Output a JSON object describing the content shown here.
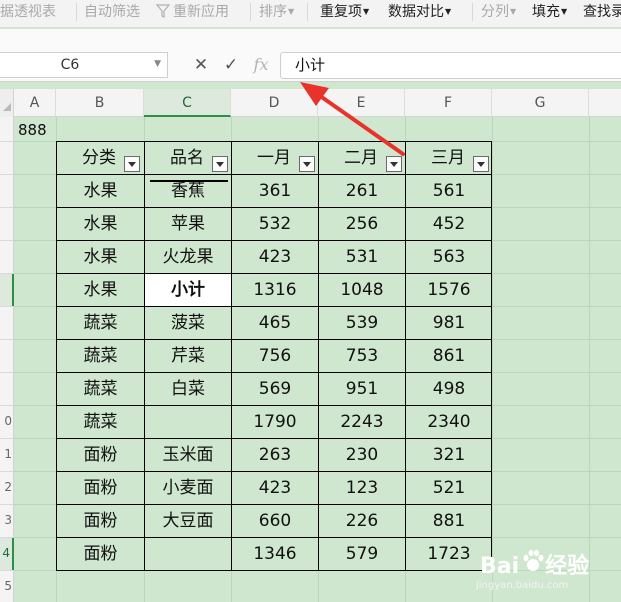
{
  "ribbon": {
    "items": [
      {
        "label": "据透视表",
        "state": "disabled",
        "dropdown": false
      },
      {
        "label": "自动筛选",
        "state": "disabled",
        "dropdown": false
      },
      {
        "label": "重新应用",
        "state": "disabled",
        "dropdown": false,
        "icon": "funnel-icon"
      },
      {
        "label": "排序",
        "state": "disabled",
        "dropdown": true
      },
      {
        "label": "重复项",
        "state": "enabled",
        "dropdown": true
      },
      {
        "label": "数据对比",
        "state": "enabled",
        "dropdown": true
      },
      {
        "label": "分列",
        "state": "disabled",
        "dropdown": true
      },
      {
        "label": "填充",
        "state": "enabled",
        "dropdown": true
      },
      {
        "label": "查找录",
        "state": "enabled",
        "dropdown": false
      }
    ]
  },
  "formula_bar": {
    "name_box": "C6",
    "cancel_icon": "✕",
    "confirm_icon": "✓",
    "fx_label": "fx",
    "value": "小计"
  },
  "grid": {
    "columns": [
      "A",
      "B",
      "C",
      "D",
      "E",
      "F",
      "G"
    ],
    "selected_column": "C",
    "row_labels": [
      "",
      "",
      "",
      "",
      "",
      "",
      "",
      "0",
      "1",
      "2",
      "3",
      "4",
      "5"
    ],
    "selected_rows": [
      "",
      "4"
    ],
    "a1_value": "888"
  },
  "table": {
    "headers": [
      "分类",
      "品名",
      "一月",
      "二月",
      "三月"
    ],
    "rows": [
      [
        "水果",
        "香蕉",
        "361",
        "261",
        "561"
      ],
      [
        "水果",
        "苹果",
        "532",
        "256",
        "452"
      ],
      [
        "水果",
        "火龙果",
        "423",
        "531",
        "563"
      ],
      [
        "水果",
        "小计",
        "1316",
        "1048",
        "1576"
      ],
      [
        "蔬菜",
        "菠菜",
        "465",
        "539",
        "981"
      ],
      [
        "蔬菜",
        "芹菜",
        "756",
        "753",
        "861"
      ],
      [
        "蔬菜",
        "白菜",
        "569",
        "951",
        "498"
      ],
      [
        "蔬菜",
        "",
        "1790",
        "2243",
        "2340"
      ],
      [
        "面粉",
        "玉米面",
        "263",
        "230",
        "321"
      ],
      [
        "面粉",
        "小麦面",
        "423",
        "123",
        "521"
      ],
      [
        "面粉",
        "大豆面",
        "660",
        "226",
        "881"
      ],
      [
        "面粉",
        "",
        "1346",
        "579",
        "1723"
      ]
    ]
  },
  "colors": {
    "sheet_bg": "#cfe6cf",
    "gray_fill": "#aec3ae",
    "arrow": "#e8322b",
    "selection": "#2f8f46"
  },
  "watermark": {
    "brand": "Bai",
    "brand_suffix": "经验",
    "url": "jingyan.baidu.com"
  }
}
